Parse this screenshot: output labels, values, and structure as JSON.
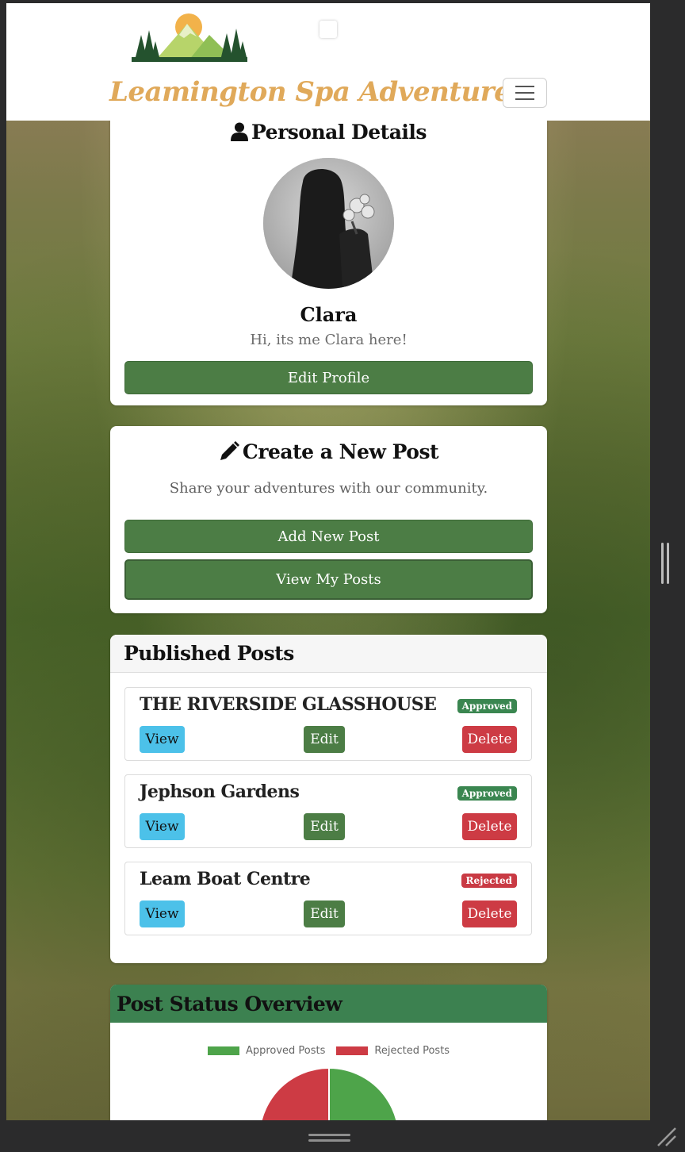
{
  "navbar": {
    "brand": "Leamington Spa Adventures",
    "logo_icon": "mountain-sun-logo-icon",
    "menu_icon": "hamburger-menu-icon"
  },
  "personal": {
    "title": "Personal Details",
    "title_icon": "user-icon",
    "name": "Clara",
    "bio": "Hi, its me Clara here!",
    "edit_button": "Edit Profile"
  },
  "create": {
    "title": "Create a New Post",
    "title_icon": "pencil-icon",
    "subtitle": "Share your adventures with our community.",
    "add_button": "Add New Post",
    "view_button": "View My Posts"
  },
  "published": {
    "title": "Published Posts",
    "posts": [
      {
        "title": "THE RIVERSIDE GLASSHOUSE",
        "status": "Approved",
        "view": "View",
        "edit": "Edit",
        "delete": "Delete"
      },
      {
        "title": "Jephson Gardens",
        "status": "Approved",
        "view": "View",
        "edit": "Edit",
        "delete": "Delete"
      },
      {
        "title": "Leam Boat Centre",
        "status": "Rejected",
        "view": "View",
        "edit": "Edit",
        "delete": "Delete"
      }
    ]
  },
  "status_overview": {
    "title": "Post Status Overview"
  },
  "chart_data": {
    "type": "pie",
    "categories": [
      "Approved Posts",
      "Rejected Posts"
    ],
    "values": [
      2,
      1
    ],
    "colors": [
      "#4ea44a",
      "#cd3b44"
    ],
    "legend": "top"
  },
  "colors": {
    "brand": "#e0a95a",
    "primary_green": "#4c7d45",
    "approved": "#3a8650",
    "rejected": "#c93a44",
    "info": "#4cc1e9"
  }
}
